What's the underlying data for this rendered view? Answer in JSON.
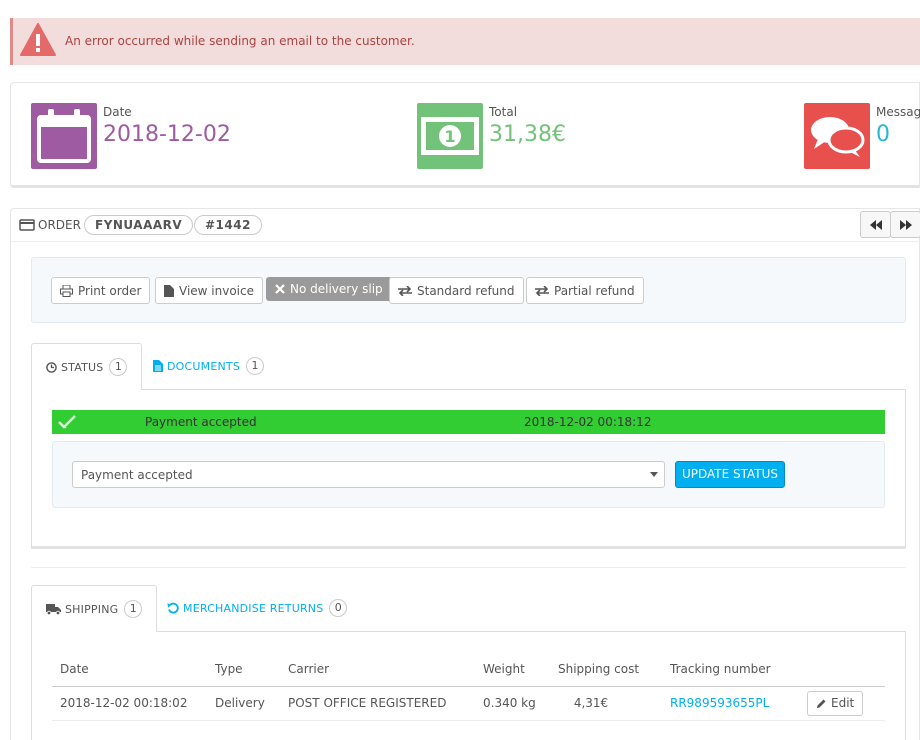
{
  "alert": {
    "message": "An error occurred while sending an email to the customer.",
    "icon": "warning-icon",
    "color": "#a94442"
  },
  "kpi": {
    "date": {
      "label": "Date",
      "value": "2018-12-02",
      "icon": "calendar-icon",
      "color": "#9e5ba1"
    },
    "total": {
      "label": "Total",
      "value": "31,38€",
      "icon": "money-icon",
      "color": "#72c279"
    },
    "messages": {
      "label": "Messages",
      "value": "0",
      "icon": "comments-icon",
      "color": "#25b9d7",
      "box_color": "#e8504e"
    }
  },
  "order": {
    "title": "ORDER",
    "reference": "FYNUAAARV",
    "id": "#1442",
    "prev_icon": "backward-icon",
    "next_icon": "forward-icon"
  },
  "toolbar": {
    "print_order": "Print order",
    "view_invoice": "View invoice",
    "no_delivery_slip": "No delivery slip",
    "standard_refund": "Standard refund",
    "partial_refund": "Partial refund"
  },
  "status_tabs": {
    "status_label": "STATUS",
    "status_count": "1",
    "documents_label": "DOCUMENTS",
    "documents_count": "1"
  },
  "status": {
    "current": "Payment accepted",
    "date": "2018-12-02 00:18:12",
    "bar_color": "#32cd32",
    "select_value": "Payment accepted",
    "update_button": "UPDATE STATUS"
  },
  "shipping_tabs": {
    "shipping_label": "SHIPPING",
    "shipping_count": "1",
    "returns_label": "MERCHANDISE RETURNS",
    "returns_count": "0"
  },
  "shipping_table": {
    "headers": [
      "Date",
      "Type",
      "Carrier",
      "Weight",
      "Shipping cost",
      "Tracking number"
    ],
    "rows": [
      {
        "date": "2018-12-02 00:18:02",
        "type": "Delivery",
        "carrier": "POST OFFICE REGISTERED",
        "weight": "0.340 kg",
        "cost": "4,31€",
        "tracking": "RR989593655PL",
        "edit": "Edit"
      }
    ]
  }
}
